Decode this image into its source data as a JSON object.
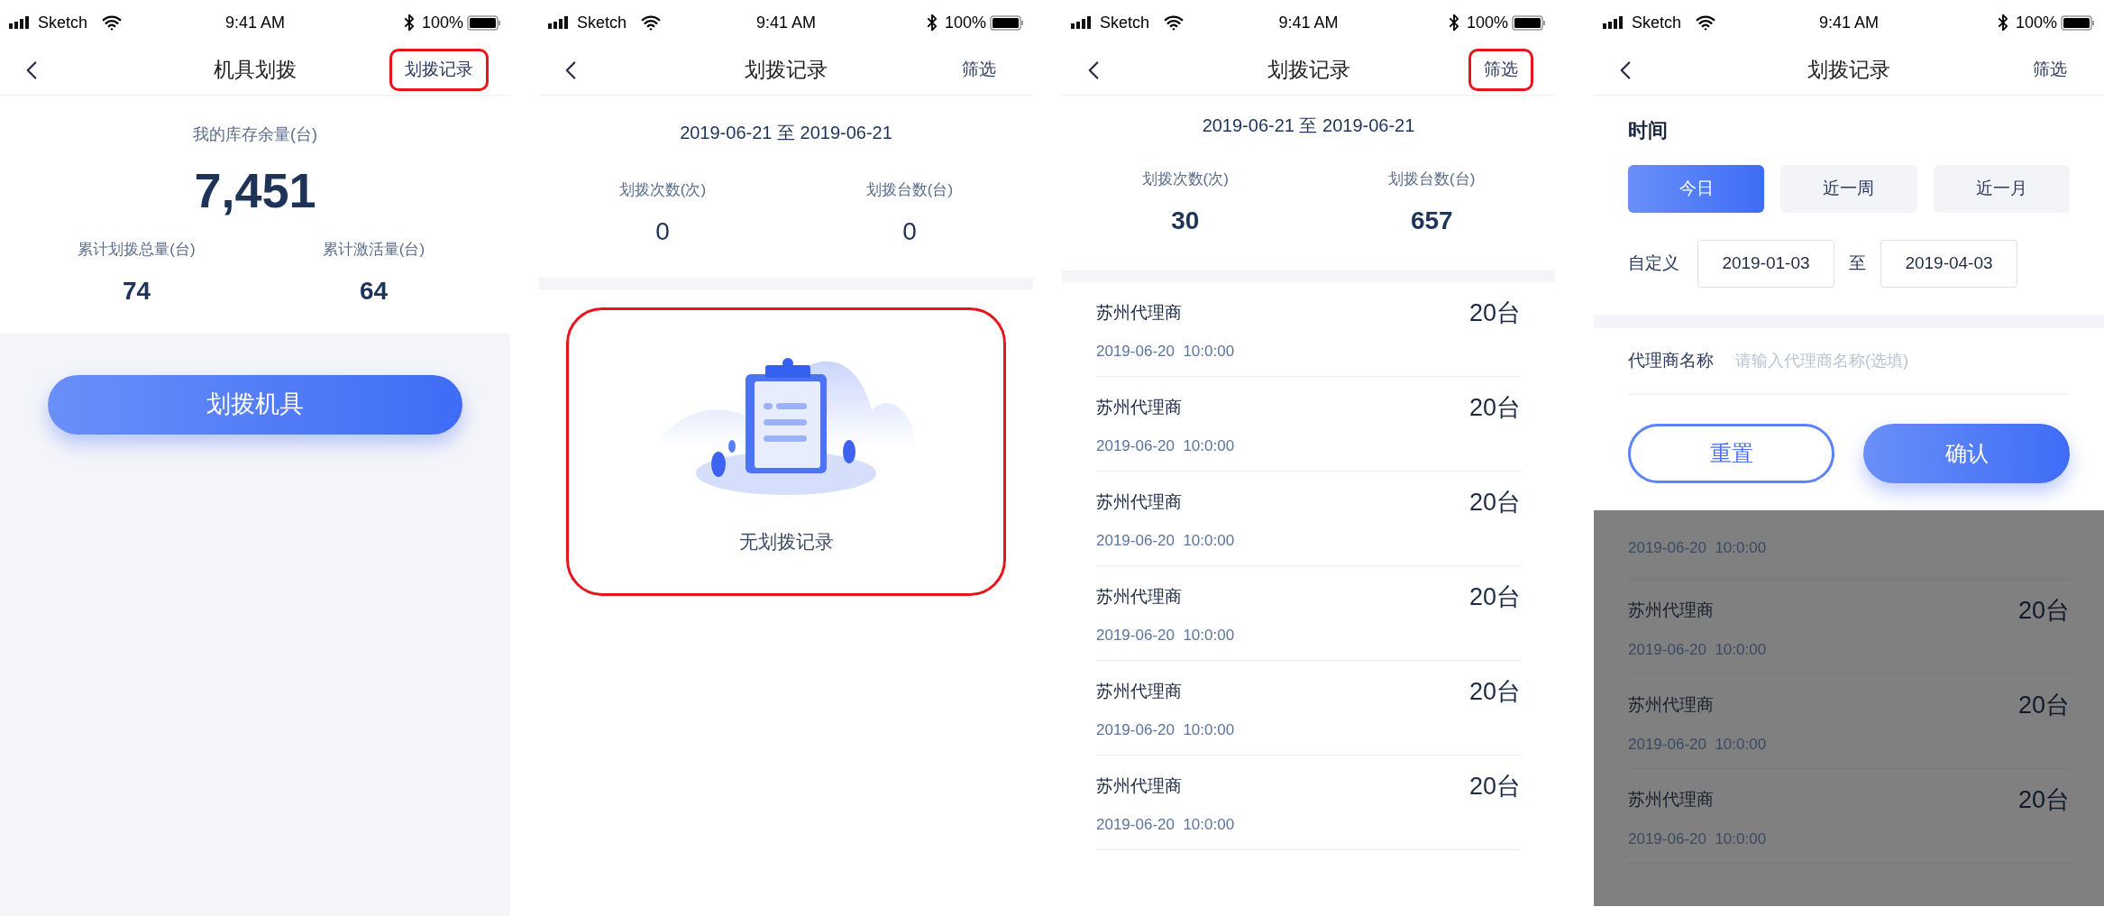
{
  "screens": [
    {
      "kind": "dispense",
      "status_bar": {
        "carrier": "Sketch",
        "time": "9:41 AM",
        "battery": "100%"
      },
      "nav": {
        "title": "机具划拨",
        "action": "划拨记录",
        "annotated": true
      },
      "stock": {
        "label": "我的库存余量(台)",
        "value": "7,451"
      },
      "stats": [
        {
          "label": "累计划拨总量(台)",
          "value": "74"
        },
        {
          "label": "累计激活量(台)",
          "value": "64"
        }
      ],
      "primary_button": "划拨机具"
    },
    {
      "kind": "records_empty",
      "status_bar": {
        "carrier": "Sketch",
        "time": "9:41 AM",
        "battery": "100%"
      },
      "nav": {
        "title": "划拨记录",
        "action": "筛选",
        "annotated": false
      },
      "date_range": "2019-06-21 至 2019-06-21",
      "stats": [
        {
          "label": "划拨次数(次)",
          "value": "0"
        },
        {
          "label": "划拨台数(台)",
          "value": "0"
        }
      ],
      "empty": {
        "text": "无划拨记录",
        "annotated": true
      }
    },
    {
      "kind": "records",
      "status_bar": {
        "carrier": "Sketch",
        "time": "9:41 AM",
        "battery": "100%"
      },
      "nav": {
        "title": "划拨记录",
        "action": "筛选",
        "annotated": true
      },
      "date_range": "2019-06-21 至 2019-06-21",
      "stats": [
        {
          "label": "划拨次数(次)",
          "value": "30"
        },
        {
          "label": "划拨台数(台)",
          "value": "657"
        }
      ],
      "rows": [
        {
          "name": "苏州代理商",
          "date": "2019-06-20",
          "time": "10:0:00",
          "count": "20台"
        },
        {
          "name": "苏州代理商",
          "date": "2019-06-20",
          "time": "10:0:00",
          "count": "20台"
        },
        {
          "name": "苏州代理商",
          "date": "2019-06-20",
          "time": "10:0:00",
          "count": "20台"
        },
        {
          "name": "苏州代理商",
          "date": "2019-06-20",
          "time": "10:0:00",
          "count": "20台"
        },
        {
          "name": "苏州代理商",
          "date": "2019-06-20",
          "time": "10:0:00",
          "count": "20台"
        },
        {
          "name": "苏州代理商",
          "date": "2019-06-20",
          "time": "10:0:00",
          "count": "20台"
        }
      ]
    },
    {
      "kind": "filter",
      "status_bar": {
        "carrier": "Sketch",
        "time": "9:41 AM",
        "battery": "100%"
      },
      "nav": {
        "title": "划拨记录",
        "action": "筛选",
        "annotated": false
      },
      "filter": {
        "section_title": "时间",
        "presets": [
          {
            "label": "今日",
            "selected": true
          },
          {
            "label": "近一周",
            "selected": false
          },
          {
            "label": "近一月",
            "selected": false
          }
        ],
        "custom_label": "自定义",
        "start": "2019-01-03",
        "separator": "至",
        "end": "2019-04-03",
        "agent_label": "代理商名称",
        "agent_placeholder": "请输入代理商名称(选填)",
        "reset": "重置",
        "confirm": "确认"
      },
      "background_rows": [
        {
          "date": "2019-06-20",
          "time": "10:0:00"
        },
        {
          "name": "苏州代理商",
          "date": "2019-06-20",
          "time": "10:0:00",
          "count": "20台"
        },
        {
          "name": "苏州代理商",
          "date": "2019-06-20",
          "time": "10:0:00",
          "count": "20台"
        },
        {
          "name": "苏州代理商",
          "date": "2019-06-20",
          "time": "10:0:00",
          "count": "20台"
        }
      ]
    }
  ]
}
